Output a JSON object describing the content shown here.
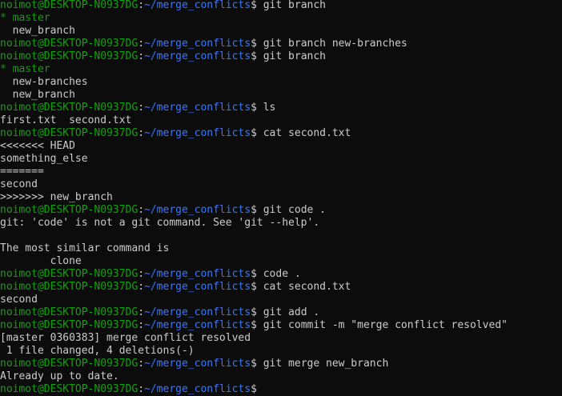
{
  "prompt": {
    "user": "noimot@DESKTOP-N0937DG",
    "sep": ":",
    "path": "~/merge_conflicts",
    "symbol": "$"
  },
  "colors": {
    "background": "#0c0c0c",
    "text": "#cccccc",
    "user": "#13a10e",
    "path": "#3b78ff"
  },
  "lines": [
    {
      "type": "cmd",
      "text": " git branch"
    },
    {
      "type": "cur",
      "text": "* master"
    },
    {
      "type": "out",
      "text": "  new_branch"
    },
    {
      "type": "cmd",
      "text": " git branch new-branches"
    },
    {
      "type": "cmd",
      "text": " git branch"
    },
    {
      "type": "cur",
      "text": "* master"
    },
    {
      "type": "out",
      "text": "  new-branches"
    },
    {
      "type": "out",
      "text": "  new_branch"
    },
    {
      "type": "cmd",
      "text": " ls"
    },
    {
      "type": "out",
      "text": "first.txt  second.txt"
    },
    {
      "type": "cmd",
      "text": " cat second.txt"
    },
    {
      "type": "out",
      "text": "<<<<<<< HEAD"
    },
    {
      "type": "out",
      "text": "something_else"
    },
    {
      "type": "out",
      "text": "======="
    },
    {
      "type": "out",
      "text": "second"
    },
    {
      "type": "out",
      "text": ">>>>>>> new_branch"
    },
    {
      "type": "cmd",
      "text": " git code ."
    },
    {
      "type": "out",
      "text": "git: 'code' is not a git command. See 'git --help'."
    },
    {
      "type": "out",
      "text": ""
    },
    {
      "type": "out",
      "text": "The most similar command is"
    },
    {
      "type": "out",
      "text": "        clone"
    },
    {
      "type": "cmd",
      "text": " code ."
    },
    {
      "type": "cmd",
      "text": " cat second.txt"
    },
    {
      "type": "out",
      "text": "second"
    },
    {
      "type": "cmd",
      "text": " git add ."
    },
    {
      "type": "cmd",
      "text": " git commit -m \"merge conflict resolved\""
    },
    {
      "type": "out",
      "text": "[master 0360383] merge conflict resolved"
    },
    {
      "type": "out",
      "text": " 1 file changed, 4 deletions(-)"
    },
    {
      "type": "cmd",
      "text": " git merge new_branch"
    },
    {
      "type": "out",
      "text": "Already up to date."
    },
    {
      "type": "cmd",
      "text": ""
    }
  ]
}
